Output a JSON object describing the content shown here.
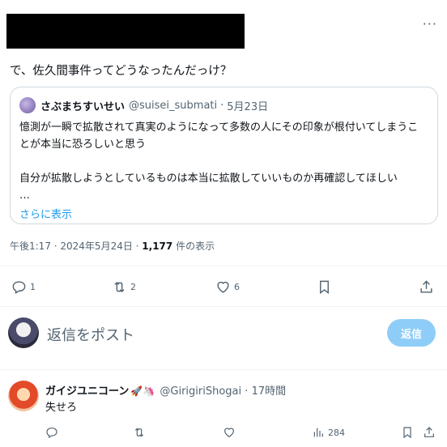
{
  "tweet": {
    "text": "で、佐久間事件ってどうなったんだっけ？",
    "more_icon": "more-icon"
  },
  "quote": {
    "name": "さぶまちすいせい",
    "handle": "@suisei_submati",
    "sep": "·",
    "date": "5月23日",
    "body": "憶測が一瞬で拡散されて真実のようになって多数の人にその印象が根付いてしまうことが本当に恐ろしいと思う\n\n自分が拡散しようとしているものは本当に拡散していいものか再確認してほしい\n…",
    "show_more": "さらに表示"
  },
  "meta": {
    "time": "午後1:17 · 2024年5月24日 · ",
    "views": "1,177",
    "views_label": " 件の表示"
  },
  "actions": {
    "reply_count": "1",
    "retweet_count": "2",
    "like_count": "6"
  },
  "reply_box": {
    "placeholder": "返信をポスト",
    "button": "返信"
  },
  "reply": {
    "name": "ガイジユニコーン",
    "emoji": "🚀🦄",
    "handle": "@GirigiriShogai",
    "sep": "·",
    "time": "17時間",
    "text": "失せろ",
    "views": "284"
  },
  "colors": {
    "accent": "#1d9bf0",
    "muted": "#536471",
    "button_disabled": "#8ecdf8"
  }
}
